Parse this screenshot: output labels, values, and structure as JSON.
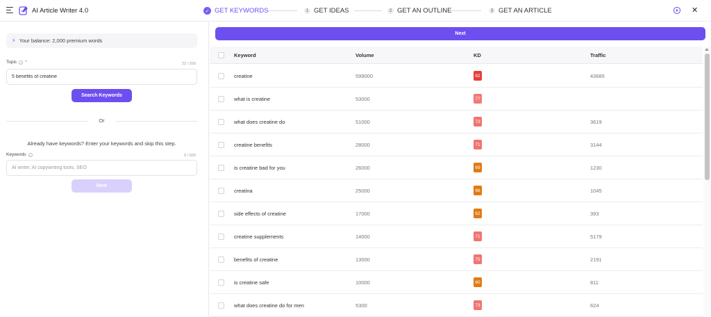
{
  "header": {
    "app_title": "AI Article Writer 4.0",
    "steps": [
      {
        "num": "",
        "label": "GET KEYWORDS",
        "active": true
      },
      {
        "num": "1",
        "label": "GET IDEAS"
      },
      {
        "num": "2",
        "label": "GET AN OUTLINE"
      },
      {
        "num": "3",
        "label": "GET AN ARTICLE"
      }
    ],
    "close_glyph": "✕"
  },
  "left": {
    "balance": "Your balance: 2,000 premium words",
    "topic": {
      "label": "Topic",
      "required_mark": "*",
      "counter": "22 / 200",
      "value": "5 benefits of creatine"
    },
    "search_button": "Search Keywords",
    "or_text": "Or",
    "helper_text": "Already have keywords? Enter your keywords and skip this step.",
    "keywords": {
      "label": "Keywords",
      "counter": "0 / 500",
      "placeholder": "AI writer, AI copywriting tools, SEO"
    },
    "next_button": "Next"
  },
  "main": {
    "next_button": "Next",
    "columns": [
      "Keyword",
      "Volume",
      "KD",
      "Traffic"
    ],
    "rows": [
      {
        "keyword": "creatine",
        "volume": "599000",
        "kd": "82",
        "kd_color": "#e53e3e",
        "traffic": "43685"
      },
      {
        "keyword": "what is creatine",
        "volume": "53000",
        "kd": "77",
        "kd_color": "#f07a74",
        "traffic": ""
      },
      {
        "keyword": "what does creatine do",
        "volume": "51000",
        "kd": "73",
        "kd_color": "#f07470",
        "traffic": "3619"
      },
      {
        "keyword": "creatine benefits",
        "volume": "28000",
        "kd": "71",
        "kd_color": "#f07470",
        "traffic": "3144"
      },
      {
        "keyword": "is creatine bad for you",
        "volume": "26000",
        "kd": "69",
        "kd_color": "#e07b14",
        "traffic": "1230"
      },
      {
        "keyword": "creatina",
        "volume": "25000",
        "kd": "66",
        "kd_color": "#e07b14",
        "traffic": "1045"
      },
      {
        "keyword": "side effects of creatine",
        "volume": "17000",
        "kd": "62",
        "kd_color": "#e07b14",
        "traffic": "393"
      },
      {
        "keyword": "creatine supplements",
        "volume": "14000",
        "kd": "71",
        "kd_color": "#f07470",
        "traffic": "5179"
      },
      {
        "keyword": "benefits of creatine",
        "volume": "13000",
        "kd": "75",
        "kd_color": "#f07470",
        "traffic": "2191"
      },
      {
        "keyword": "is creatine safe",
        "volume": "10000",
        "kd": "60",
        "kd_color": "#e07b14",
        "traffic": "811"
      },
      {
        "keyword": "what does creatine do for men",
        "volume": "5300",
        "kd": "73",
        "kd_color": "#f07470",
        "traffic": "624"
      }
    ]
  },
  "colors": {
    "accent": "#6d4ff0",
    "accent_disabled": "#d9d1fb"
  }
}
